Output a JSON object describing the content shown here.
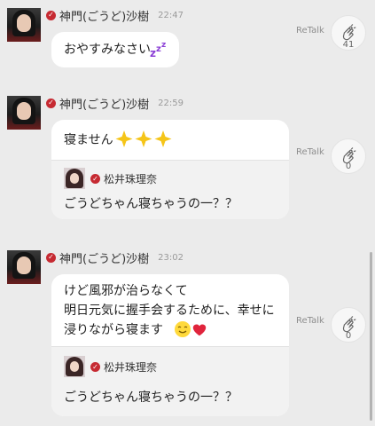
{
  "posts": [
    {
      "author": "神門(ごうど)沙樹",
      "time": "22:47",
      "text": "おやすみなさい",
      "retalk": "ReTalk",
      "clap_count": "41"
    },
    {
      "author": "神門(ごうど)沙樹",
      "time": "22:59",
      "text": "寝ません",
      "retalk": "ReTalk",
      "clap_count": "0",
      "quote": {
        "author": "松井珠理奈",
        "text": "ごうどちゃん寝ちゃうの一？？"
      }
    },
    {
      "author": "神門(ごうど)沙樹",
      "time": "23:02",
      "text": "けど風邪が治らなくて\n明日元気に握手会するために、幸せに\n浸りながら寝ます",
      "retalk": "ReTalk",
      "clap_count": "0",
      "quote": {
        "author": "松井珠理奈",
        "text": "ごうどちゃん寝ちゃうの一？？"
      }
    }
  ],
  "icons": {
    "verified": "check-badge-icon",
    "clap": "clapping-hands-icon",
    "sleep": "zzz-emoji",
    "sparkles": "sparkles-emoji",
    "smile": "smiling-face-emoji",
    "heart": "heart-emoji"
  },
  "colors": {
    "background": "#ebebeb",
    "verified_badge": "#c62a32",
    "bubble": "#ffffff",
    "quote_bg": "#f2f2f2",
    "zzz": "#8b3fd6",
    "sparkle": "#f5c518",
    "heart": "#e0243c"
  }
}
